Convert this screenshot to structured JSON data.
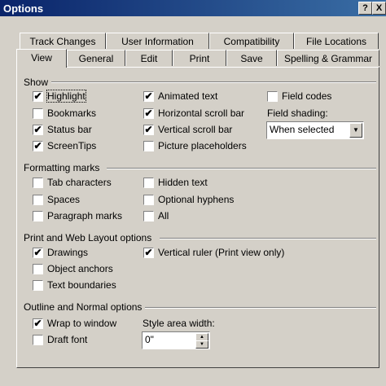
{
  "window": {
    "title": "Options",
    "help_label": "?",
    "close_label": "X"
  },
  "tabs": {
    "row_back": [
      "Track Changes",
      "User Information",
      "Compatibility",
      "File Locations"
    ],
    "row_front": [
      "View",
      "General",
      "Edit",
      "Print",
      "Save",
      "Spelling & Grammar"
    ],
    "active": "View"
  },
  "show": {
    "label": "Show",
    "highlight": {
      "label": "Highlight",
      "checked": true
    },
    "bookmarks": {
      "label": "Bookmarks",
      "checked": false
    },
    "status_bar": {
      "label": "Status bar",
      "checked": true
    },
    "screentips": {
      "label": "ScreenTips",
      "checked": true
    },
    "animated_text": {
      "label": "Animated text",
      "checked": true
    },
    "horizontal_scroll_bar": {
      "label": "Horizontal scroll bar",
      "checked": true
    },
    "vertical_scroll_bar": {
      "label": "Vertical scroll bar",
      "checked": true
    },
    "picture_placeholders": {
      "label": "Picture placeholders",
      "checked": false
    },
    "field_codes": {
      "label": "Field codes",
      "checked": false
    },
    "field_shading": {
      "label": "Field shading:",
      "value": "When selected"
    }
  },
  "formatting_marks": {
    "label": "Formatting marks",
    "tab_characters": {
      "label": "Tab characters",
      "checked": false
    },
    "spaces": {
      "label": "Spaces",
      "checked": false
    },
    "paragraph_marks": {
      "label": "Paragraph marks",
      "checked": false
    },
    "hidden_text": {
      "label": "Hidden text",
      "checked": false
    },
    "optional_hyphens": {
      "label": "Optional hyphens",
      "checked": false
    },
    "all": {
      "label": "All",
      "checked": false
    }
  },
  "print_web": {
    "label": "Print and Web Layout options",
    "drawings": {
      "label": "Drawings",
      "checked": true
    },
    "object_anchors": {
      "label": "Object anchors",
      "checked": false
    },
    "text_boundaries": {
      "label": "Text boundaries",
      "checked": false
    },
    "vertical_ruler": {
      "label": "Vertical ruler (Print view only)",
      "checked": true
    }
  },
  "outline_normal": {
    "label": "Outline and Normal options",
    "wrap_to_window": {
      "label": "Wrap to window",
      "checked": true
    },
    "draft_font": {
      "label": "Draft font",
      "checked": false
    },
    "style_area_width": {
      "label": "Style area width:",
      "value": "0\""
    }
  },
  "glyphs": {
    "check": "✔",
    "arrow_down": "▼",
    "arrow_up": "▲"
  }
}
